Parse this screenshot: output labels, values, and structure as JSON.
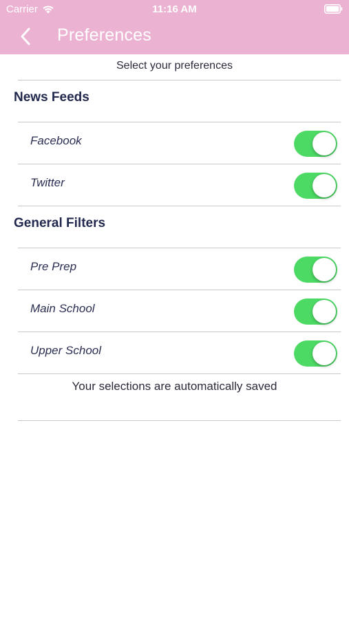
{
  "status_bar": {
    "carrier": "Carrier",
    "time": "11:16 AM",
    "icons": [
      "wifi-icon",
      "battery-icon"
    ]
  },
  "nav": {
    "title": "Preferences",
    "back_icon": "chevron-left-icon"
  },
  "intro_text": "Select your preferences",
  "sections": [
    {
      "title": "News Feeds",
      "items": [
        {
          "label": "Facebook",
          "enabled": true
        },
        {
          "label": "Twitter",
          "enabled": true
        }
      ]
    },
    {
      "title": "General Filters",
      "items": [
        {
          "label": "Pre Prep",
          "enabled": true
        },
        {
          "label": "Main School",
          "enabled": true
        },
        {
          "label": "Upper School",
          "enabled": true
        }
      ]
    }
  ],
  "footer_note": "Your selections are automatically saved",
  "colors": {
    "header": "#ecb2d2",
    "toggle_on": "#4cd964",
    "text_dark": "#22284e"
  }
}
